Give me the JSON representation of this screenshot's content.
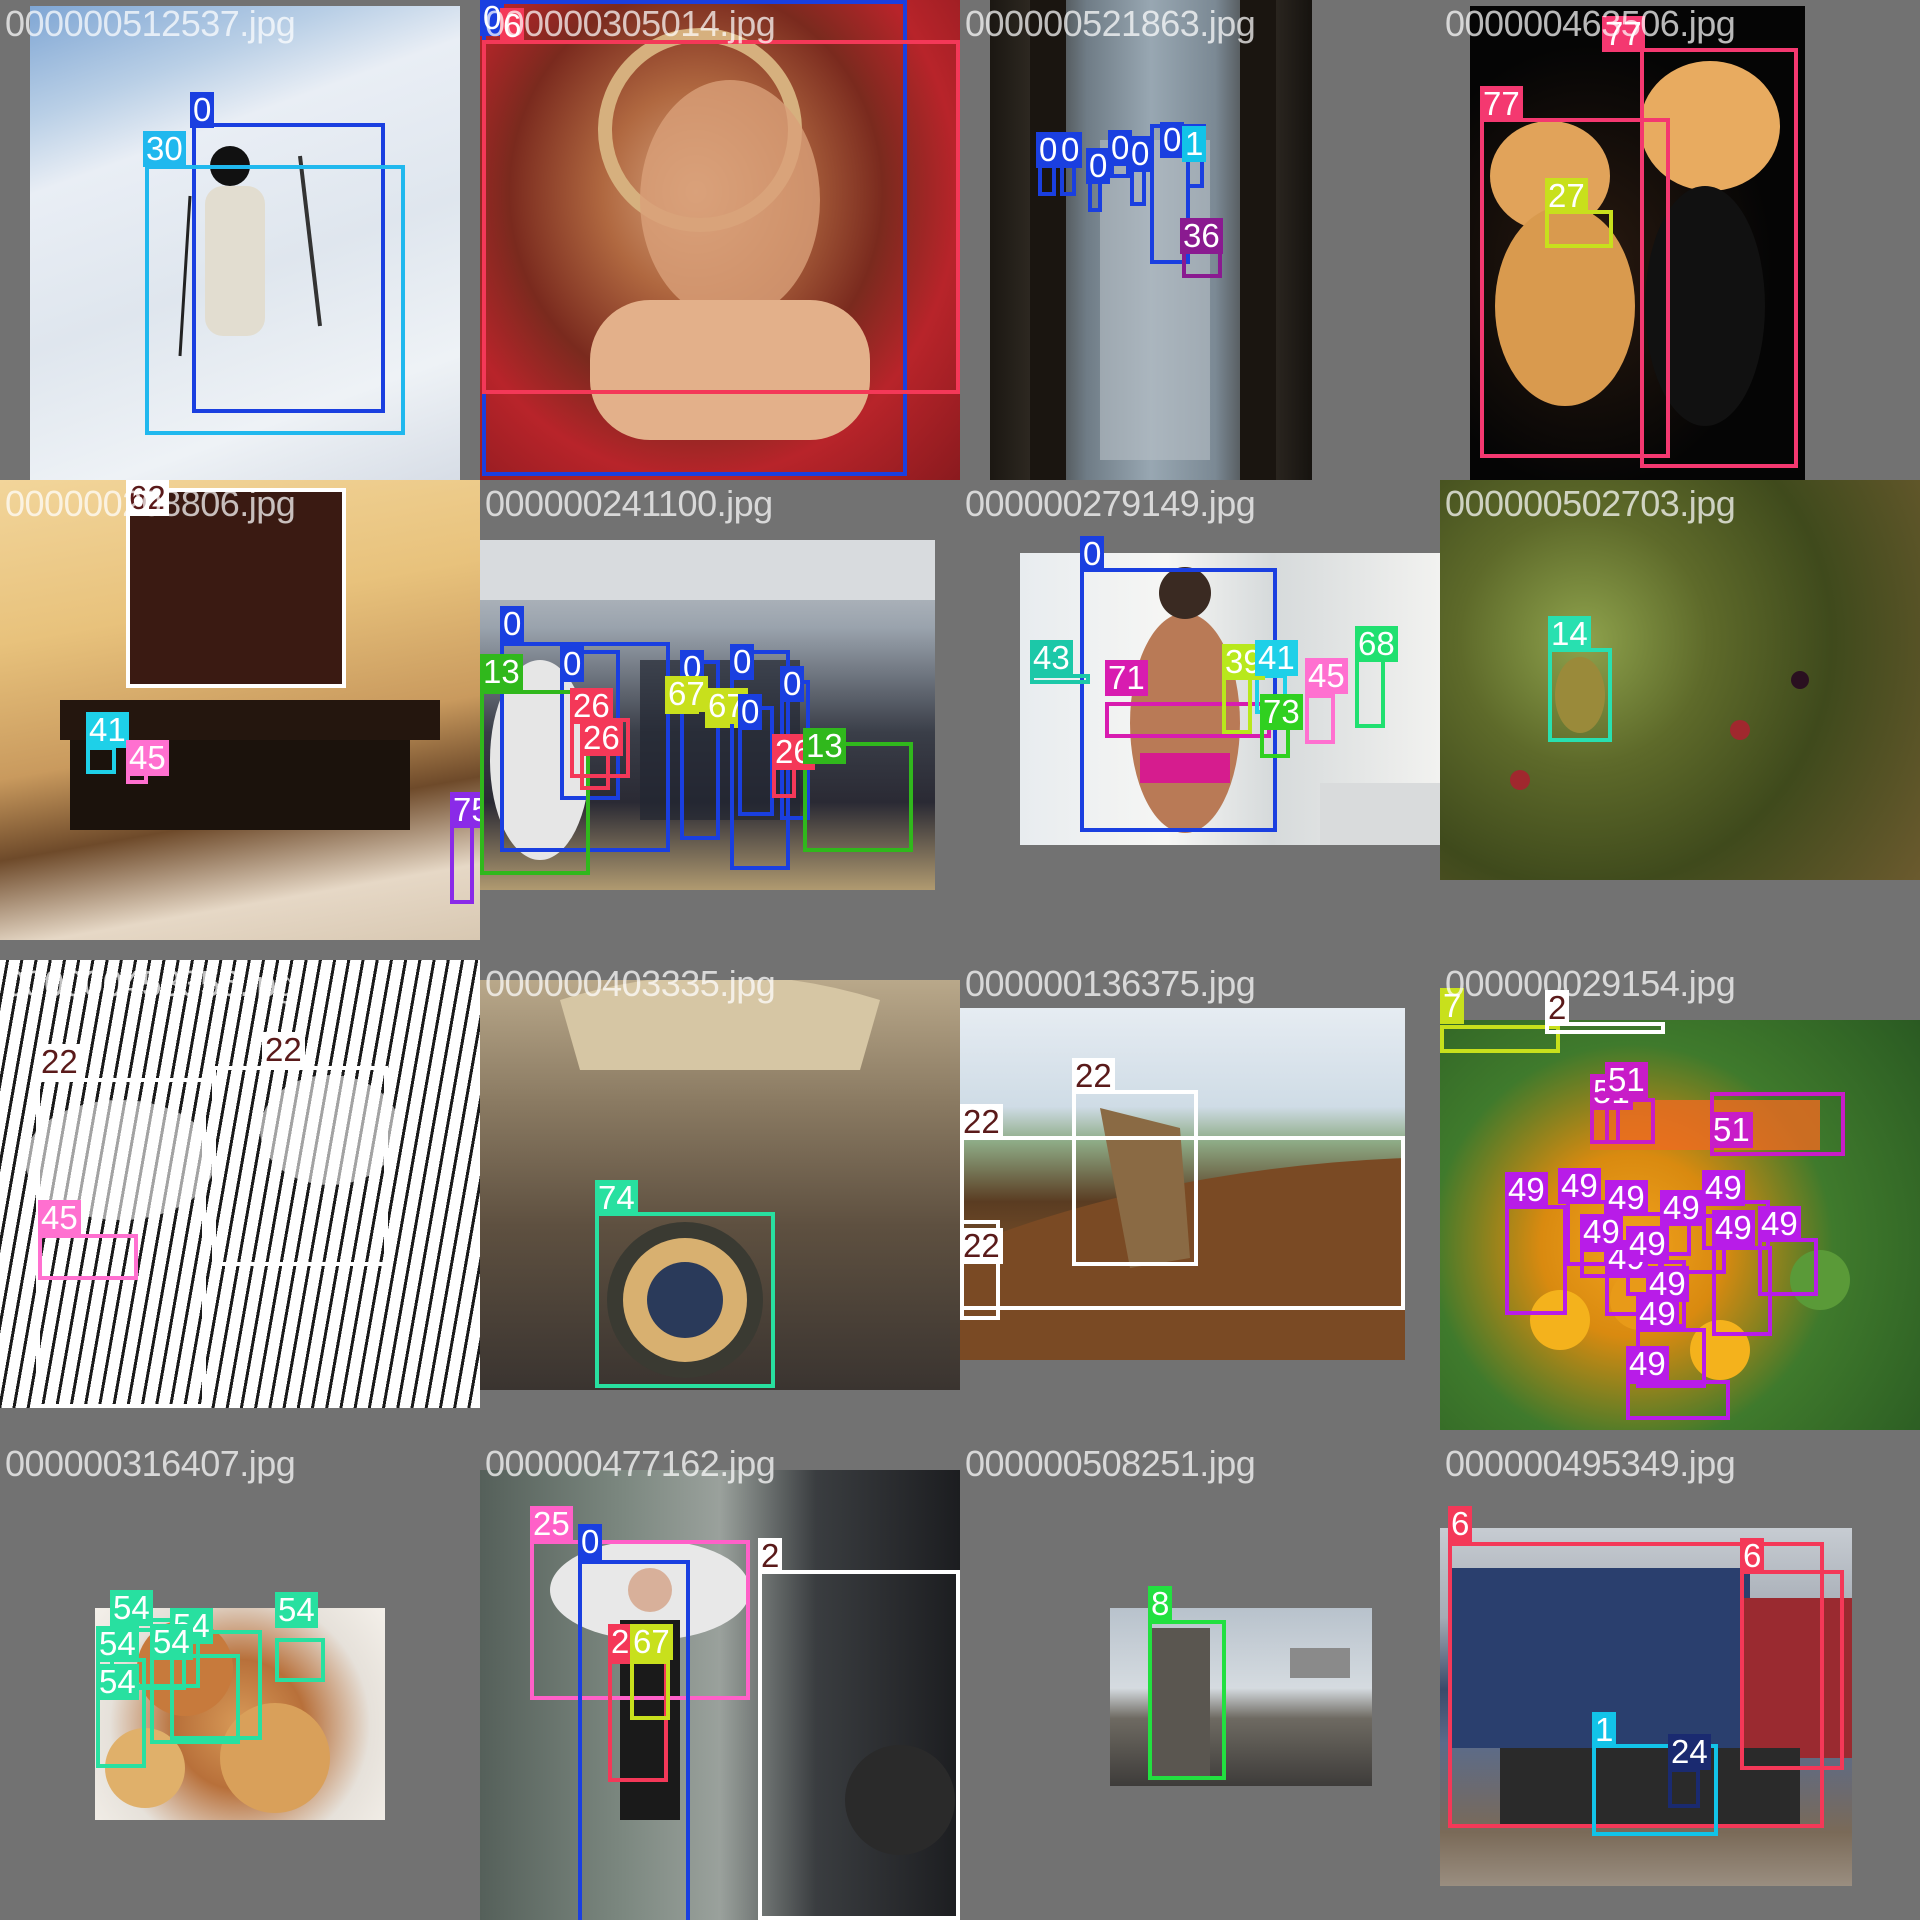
{
  "mosaic": {
    "cells": [
      {
        "file": "000000512537.jpg",
        "labels": [
          "0",
          "30"
        ]
      },
      {
        "file": "000000305014.jpg",
        "labels": [
          "0",
          "6"
        ]
      },
      {
        "file": "000000521863.jpg",
        "labels": [
          "0",
          "0",
          "0",
          "0",
          "0",
          "0",
          "0",
          "1",
          "36"
        ]
      },
      {
        "file": "000000463506.jpg",
        "labels": [
          "77",
          "77",
          "27"
        ]
      },
      {
        "file": "000000208806.jpg",
        "labels": [
          "62",
          "41",
          "45",
          "75"
        ]
      },
      {
        "file": "000000241100.jpg",
        "labels": [
          "0",
          "0",
          "13",
          "0",
          "26",
          "26",
          "67",
          "67",
          "0",
          "0",
          "0",
          "26",
          "13"
        ]
      },
      {
        "file": "000000279149.jpg",
        "labels": [
          "0",
          "43",
          "71",
          "39",
          "41",
          "73",
          "45",
          "68"
        ]
      },
      {
        "file": "000000502703.jpg",
        "labels": [
          "14"
        ]
      },
      {
        "file": "000000453356.jpg",
        "labels": [
          "22",
          "22",
          "45"
        ]
      },
      {
        "file": "000000403335.jpg",
        "labels": [
          "74"
        ]
      },
      {
        "file": "000000136375.jpg",
        "labels": [
          "22",
          "22",
          "22"
        ]
      },
      {
        "file": "000000029154.jpg",
        "labels": [
          "7",
          "2",
          "51",
          "51",
          "51",
          "49",
          "49",
          "49",
          "49",
          "49",
          "49",
          "49",
          "49",
          "49",
          "49",
          "49",
          "49",
          "49"
        ]
      },
      {
        "file": "000000316407.jpg",
        "labels": [
          "54",
          "54",
          "54",
          "54",
          "54",
          "54"
        ]
      },
      {
        "file": "000000477162.jpg",
        "labels": [
          "25",
          "0",
          "2",
          "26",
          "67"
        ]
      },
      {
        "file": "000000508251.jpg",
        "labels": [
          "8"
        ]
      },
      {
        "file": "000000495349.jpg",
        "labels": [
          "6",
          "6",
          "1",
          "24"
        ]
      }
    ]
  },
  "colors": {
    "0": "#1a3fe0",
    "1": "#12c3e8",
    "2": "#ffffff",
    "6": "#f43858",
    "7": "#c8e01c",
    "8": "#22e040",
    "13": "#30b81c",
    "14": "#28e0b0",
    "22": "#ffffff",
    "24": "#1a2a70",
    "25": "#ff60c8",
    "26": "#f43858",
    "27": "#c8e01c",
    "30": "#20b8ee",
    "36": "#8a1a90",
    "39": "#b8e81c",
    "41": "#1ed0e8",
    "43": "#1cc8a8",
    "45": "#ff70d0",
    "49": "#b81ce8",
    "51": "#c81cc8",
    "54": "#28e0a0",
    "62": "#ffffff",
    "67": "#c8e01c",
    "68": "#20e070",
    "71": "#d81cb0",
    "73": "#30d020",
    "74": "#28e0a0",
    "75": "#8a2ae8",
    "77": "#f43870"
  }
}
